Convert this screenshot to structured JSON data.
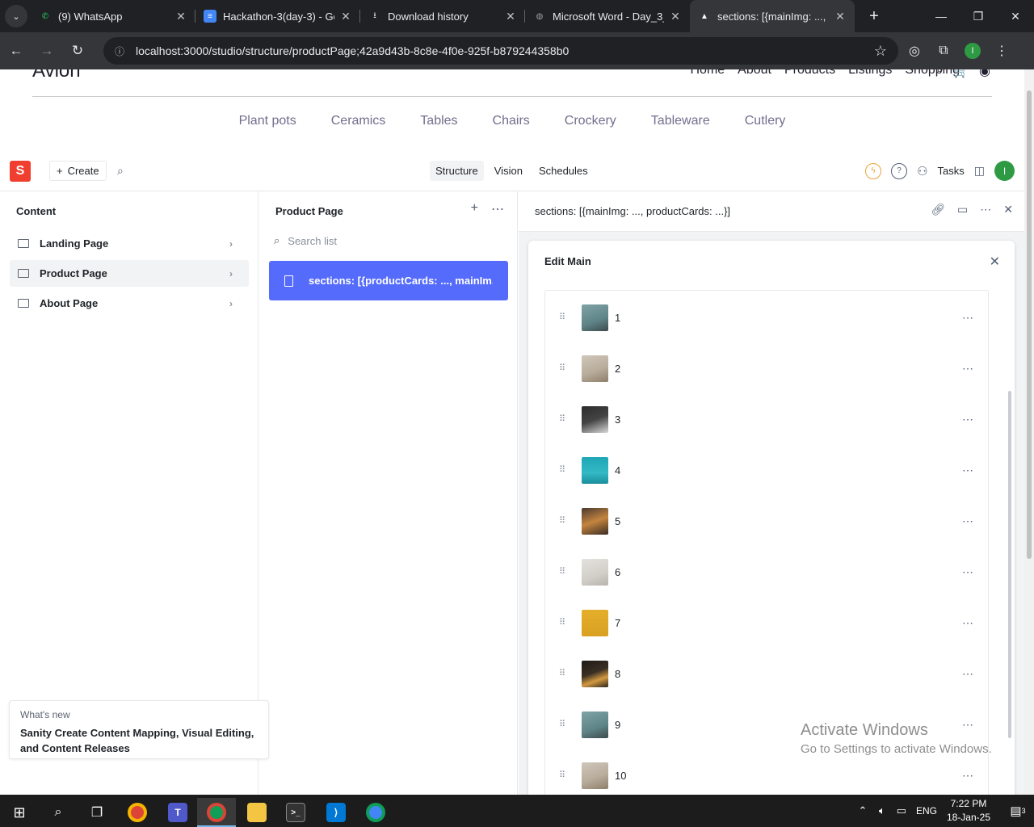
{
  "browser": {
    "tabs": [
      {
        "title": "(9) WhatsApp",
        "icon": "whatsapp-icon",
        "color": "#25d366"
      },
      {
        "title": "Hackathon-3(day-3) - Go",
        "icon": "docs-icon",
        "color": "#4285f4"
      },
      {
        "title": "Download history",
        "icon": "download-icon",
        "color": "#e8eaed"
      },
      {
        "title": "Microsoft Word - Day_3_",
        "icon": "globe-icon",
        "color": "#9aa0a6"
      },
      {
        "title": "sections: [{mainImg: ..., pr",
        "icon": "vercel-icon",
        "color": "#ffffff"
      }
    ],
    "url": "localhost:3000/studio/structure/productPage;42a9d43b-8c8e-4f0e-925f-b879244358b0",
    "profile_initial": "I"
  },
  "site": {
    "brand": "Avion",
    "nav": [
      "Home",
      "About",
      "Products",
      "Listings",
      "Shopping"
    ],
    "categories": [
      "Plant pots",
      "Ceramics",
      "Tables",
      "Chairs",
      "Crockery",
      "Tableware",
      "Cutlery"
    ]
  },
  "studio": {
    "create_label": "Create",
    "tools": [
      "Structure",
      "Vision",
      "Schedules"
    ],
    "tasks_label": "Tasks",
    "avatar_initial": "I",
    "content_pane": {
      "title": "Content",
      "items": [
        "Landing Page",
        "Product Page",
        "About Page"
      ],
      "selected": "Product Page"
    },
    "list_pane": {
      "title": "Product Page",
      "search_placeholder": "Search list",
      "document_title": "sections: [{productCards: ..., mainIm..."
    },
    "doc_pane": {
      "title": "sections: [{mainImg: ..., productCards: ...}]",
      "dialog_title": "Edit Main",
      "items": [
        {
          "label": "1",
          "thumb": "chair-photo"
        },
        {
          "label": "2",
          "thumb": "ceramics-photo"
        },
        {
          "label": "3",
          "thumb": "vase-photo"
        },
        {
          "label": "4",
          "thumb": "lamp-photo"
        },
        {
          "label": "5",
          "thumb": "pendant-lights-photo"
        },
        {
          "label": "6",
          "thumb": "decor-photo"
        },
        {
          "label": "7",
          "thumb": "yellow-photo"
        },
        {
          "label": "8",
          "thumb": "dark-lamp-photo"
        },
        {
          "label": "9",
          "thumb": "chair-photo"
        },
        {
          "label": "10",
          "thumb": "ceramics-photo"
        }
      ]
    },
    "whats_new": {
      "label": "What's new",
      "text": "Sanity Create Content Mapping, Visual Editing, and Content Releases"
    }
  },
  "watermark": {
    "line1": "Activate Windows",
    "line2": "Go to Settings to activate Windows."
  },
  "taskbar": {
    "lang": "ENG",
    "time": "7:22 PM",
    "date": "18-Jan-25",
    "notification_count": "3"
  }
}
